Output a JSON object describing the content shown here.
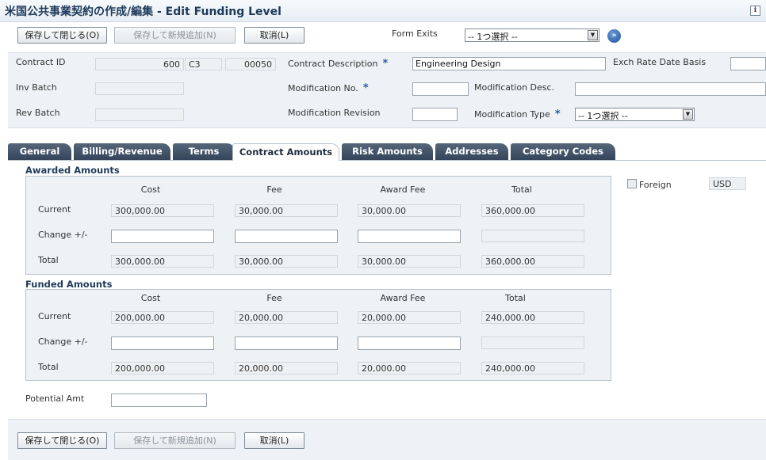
{
  "window": {
    "title": "米国公共事業契約の作成/編集 - Edit Funding Level",
    "info_icon": "i"
  },
  "toolbar": {
    "save_close": "保存して閉じる(O)",
    "save_add_new": "保存して新規追加(N)",
    "cancel": "取消(L)",
    "form_exits_label": "Form Exits",
    "form_exits_value": "-- 1つ選択 --",
    "go_icon": "»"
  },
  "header": {
    "contract_id_label": "Contract ID",
    "contract_id": "600",
    "contract_type": "C3",
    "contract_company": "00050",
    "contract_desc_label": "Contract Description",
    "contract_desc_value": "Engineering Design",
    "exch_rate_label": "Exch Rate Date Basis",
    "exch_rate_value": "",
    "inv_batch_label": "Inv Batch",
    "inv_batch_value": "",
    "rev_batch_label": "Rev Batch",
    "rev_batch_value": "",
    "mod_no_label": "Modification No.",
    "mod_no_value": "",
    "mod_desc_label": "Modification Desc.",
    "mod_desc_value": "",
    "mod_rev_label": "Modification Revision",
    "mod_rev_value": "",
    "mod_type_label": "Modification Type",
    "mod_type_value": "-- 1つ選択 --",
    "required_marker": "*"
  },
  "tabs": [
    {
      "label": "General"
    },
    {
      "label": "Billing/Revenue"
    },
    {
      "label": "Terms"
    },
    {
      "label": "Contract Amounts"
    },
    {
      "label": "Risk Amounts"
    },
    {
      "label": "Addresses"
    },
    {
      "label": "Category Codes"
    }
  ],
  "active_tab": "Contract Amounts",
  "awarded": {
    "title": "Awarded Amounts",
    "columns": [
      "Cost",
      "Fee",
      "Award Fee",
      "Total"
    ],
    "rows": [
      {
        "label": "Current",
        "values": [
          "300,000.00",
          "30,000.00",
          "30,000.00",
          "360,000.00"
        ]
      },
      {
        "label": "Change +/-",
        "values": [
          "",
          "",
          "",
          ""
        ]
      },
      {
        "label": "Total",
        "values": [
          "300,000.00",
          "30,000.00",
          "30,000.00",
          "360,000.00"
        ]
      }
    ]
  },
  "funded": {
    "title": "Funded Amounts",
    "columns": [
      "Cost",
      "Fee",
      "Award Fee",
      "Total"
    ],
    "rows": [
      {
        "label": "Current",
        "values": [
          "200,000.00",
          "20,000.00",
          "20,000.00",
          "240,000.00"
        ]
      },
      {
        "label": "Change +/-",
        "values": [
          "",
          "",
          "",
          ""
        ]
      },
      {
        "label": "Total",
        "values": [
          "200,000.00",
          "20,000.00",
          "20,000.00",
          "240,000.00"
        ]
      }
    ]
  },
  "foreign": {
    "label": "Foreign",
    "currency": "USD",
    "checked": false
  },
  "potential": {
    "label": "Potential Amt",
    "value": ""
  }
}
